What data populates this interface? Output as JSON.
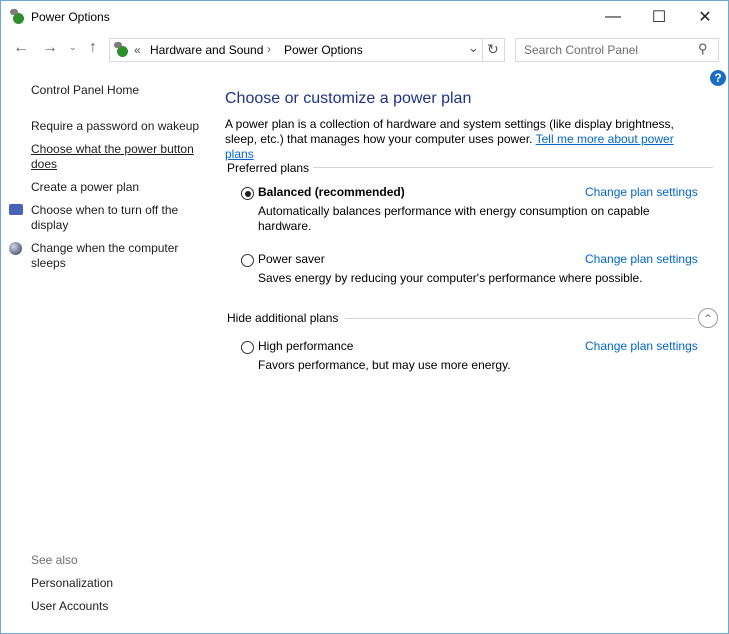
{
  "window": {
    "title": "Power Options",
    "minimize_icon": "minimize-icon",
    "maximize_icon": "maximize-icon",
    "close_icon": "close-icon"
  },
  "nav": {
    "overflow": "«",
    "breadcrumb": [
      "Hardware and Sound",
      "Power Options"
    ],
    "search_placeholder": "Search Control Panel"
  },
  "sidebar": {
    "home": "Control Panel Home",
    "items": [
      {
        "label": "Require a password on wakeup"
      },
      {
        "label": "Choose what the power button does"
      },
      {
        "label": "Create a power plan"
      },
      {
        "label": "Choose when to turn off the display"
      },
      {
        "label": "Change when the computer sleeps"
      }
    ],
    "see_also_title": "See also",
    "see_also": [
      "Personalization",
      "User Accounts"
    ]
  },
  "main": {
    "title": "Choose or customize a power plan",
    "intro": "A power plan is a collection of hardware and system settings (like display brightness, sleep, etc.) that manages how your computer uses power.",
    "intro_link": "Tell me more about power plans",
    "preferred_label": "Preferred plans",
    "hide_label": "Hide additional plans",
    "plans": [
      {
        "name": "Balanced (recommended)",
        "selected": true,
        "desc": "Automatically balances performance with energy consumption on capable hardware.",
        "link": "Change plan settings"
      },
      {
        "name": "Power saver",
        "selected": false,
        "desc": "Saves energy by reducing your computer's performance where possible.",
        "link": "Change plan settings"
      },
      {
        "name": "High performance",
        "selected": false,
        "desc": "Favors performance, but may use more energy.",
        "link": "Change plan settings"
      }
    ]
  },
  "colors": {
    "link": "#0066cc",
    "heading": "#1e3287",
    "border": "#6aa8d6"
  }
}
